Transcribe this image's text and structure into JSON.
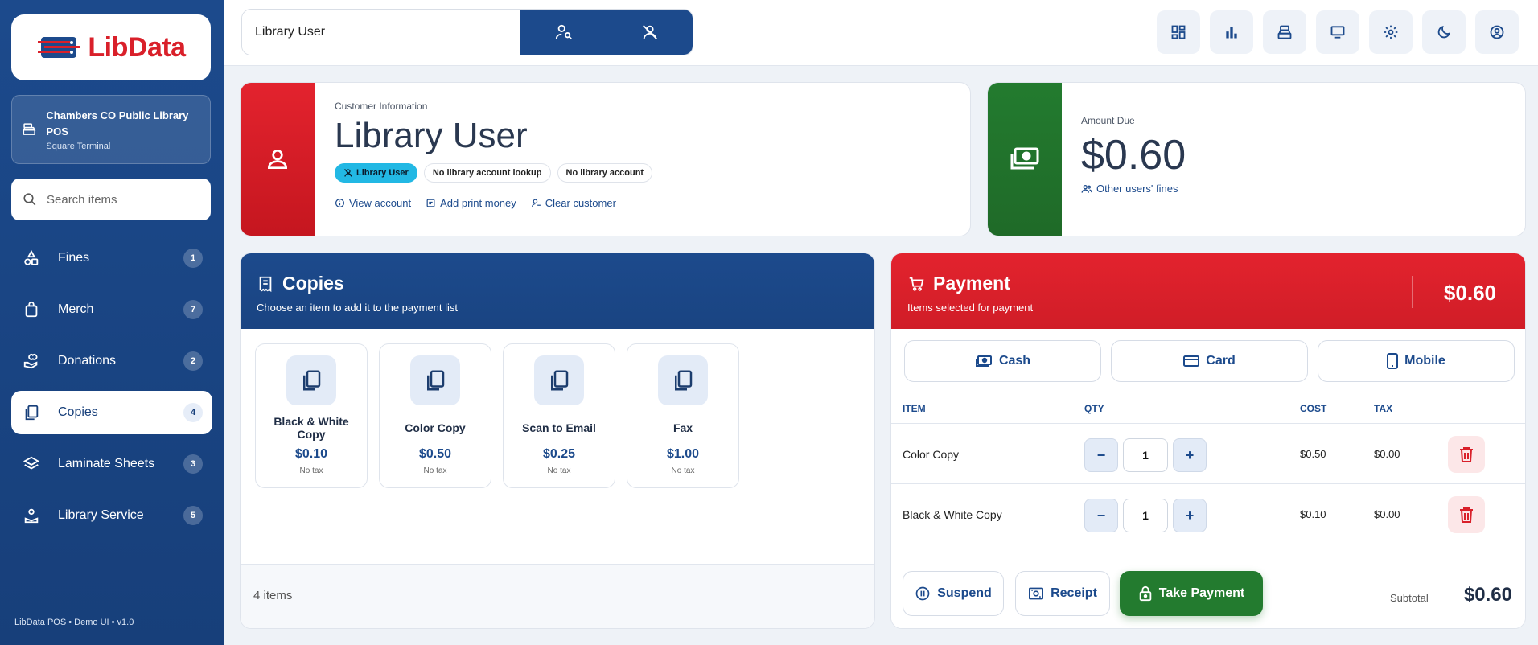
{
  "app": {
    "logo_text": "LibData",
    "branch_name": "Chambers CO Public Library POS",
    "branch_terminal": "Square Terminal",
    "footer": "LibData POS • Demo UI • v1.0"
  },
  "sidebar": {
    "search_placeholder": "Search items",
    "items": [
      {
        "label": "Fines",
        "count": "1",
        "icon": "fines-icon"
      },
      {
        "label": "Merch",
        "count": "7",
        "icon": "shopping-bag-icon"
      },
      {
        "label": "Donations",
        "count": "2",
        "icon": "donation-hand-icon"
      },
      {
        "label": "Copies",
        "count": "4",
        "icon": "copy-icon",
        "active": true
      },
      {
        "label": "Laminate Sheets",
        "count": "3",
        "icon": "layers-icon"
      },
      {
        "label": "Library Service",
        "count": "5",
        "icon": "service-icon"
      }
    ]
  },
  "topbar": {
    "customer_search_value": "Library User",
    "icons": [
      "dashboard-icon",
      "chart-icon",
      "register-icon",
      "monitor-icon",
      "gear-icon",
      "moon-icon",
      "user-circle-icon"
    ]
  },
  "customer": {
    "section_label": "Customer Information",
    "name": "Library User",
    "tags": [
      "Library User",
      "No library account lookup",
      "No library account"
    ],
    "links": {
      "view": "View account",
      "print_money": "Add print money",
      "clear": "Clear customer"
    }
  },
  "amount_due": {
    "label": "Amount Due",
    "value": "$0.60",
    "link": "Other users' fines"
  },
  "copies": {
    "title": "Copies",
    "subtitle": "Choose an item to add it to the payment list",
    "products": [
      {
        "name": "Black & White Copy",
        "price": "$0.10",
        "tax": "No tax"
      },
      {
        "name": "Color Copy",
        "price": "$0.50",
        "tax": "No tax"
      },
      {
        "name": "Scan to Email",
        "price": "$0.25",
        "tax": "No tax"
      },
      {
        "name": "Fax",
        "price": "$1.00",
        "tax": "No tax"
      }
    ],
    "footer": "4 items"
  },
  "payment": {
    "title": "Payment",
    "subtitle": "Items selected for payment",
    "total": "$0.60",
    "methods": {
      "cash": "Cash",
      "card": "Card",
      "mobile": "Mobile"
    },
    "columns": {
      "item": "ITEM",
      "qty": "QTY",
      "cost": "COST",
      "tax": "TAX"
    },
    "rows": [
      {
        "item": "Color Copy",
        "qty": "1",
        "cost": "$0.50",
        "tax": "$0.00"
      },
      {
        "item": "Black & White Copy",
        "qty": "1",
        "cost": "$0.10",
        "tax": "$0.00"
      }
    ],
    "buttons": {
      "suspend": "Suspend",
      "receipt": "Receipt",
      "take_payment": "Take Payment"
    },
    "subtotal_label": "Subtotal",
    "subtotal_value": "$0.60"
  }
}
